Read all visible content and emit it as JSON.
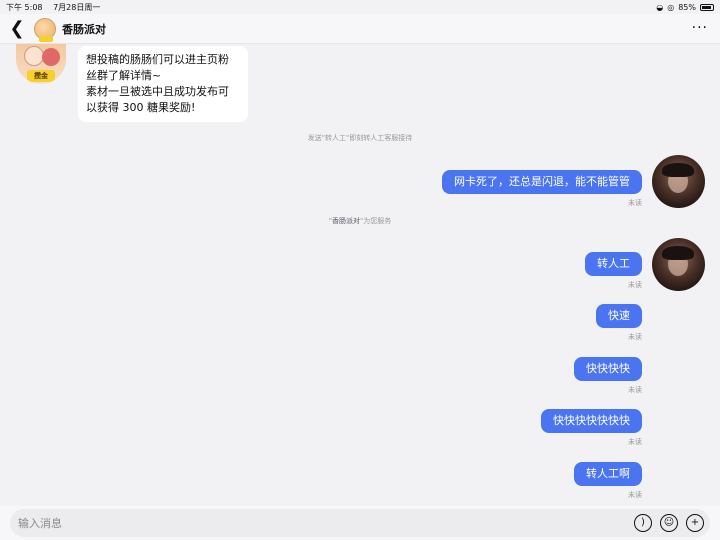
{
  "status": {
    "time": "下午 5:08",
    "date": "7月28日周一",
    "battery": "85%"
  },
  "header": {
    "title": "香肠派对",
    "more_icon": "more-dots-icon"
  },
  "avatar_badge": "攒金",
  "incoming_message": {
    "line1": "想投稿的肠肠们可以进主页粉",
    "line2": "丝群了解详情~",
    "line3": "素材一旦被选中且成功发布可",
    "line4": "以获得 300 糖果奖励!"
  },
  "system_notes": {
    "transfer_hint": "发送\"转人工\"即刻转人工客服接待",
    "service_prefix": "\"",
    "service_name": "香肠派对",
    "service_suffix": "\"为您服务"
  },
  "outgoing_messages": [
    {
      "text": "网卡死了，还总是闪退，能不能管管",
      "status": "未读"
    },
    {
      "text": "转人工",
      "status": "未读"
    },
    {
      "text": "快速",
      "status": "未读"
    },
    {
      "text": "快快快快",
      "status": "未读"
    },
    {
      "text": "快快快快快快快",
      "status": "未读"
    },
    {
      "text": "转人工啊",
      "status": "未读"
    }
  ],
  "input": {
    "placeholder": "输入消息"
  },
  "icons": {
    "voice": "voice-icon",
    "emoji": "emoji-icon",
    "plus": "plus-icon"
  }
}
